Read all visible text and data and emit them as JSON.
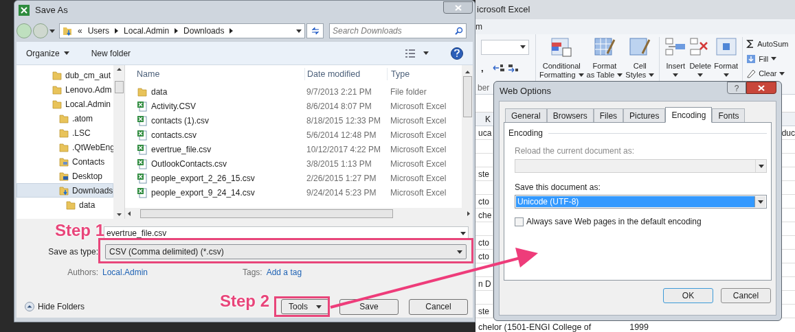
{
  "excel": {
    "title": "icrosoft Excel",
    "tab_fragment": "m",
    "group_fragment": "ber",
    "comma": ",",
    "ribbon": [
      {
        "lines": [
          "Conditional",
          "Formatting"
        ],
        "menu": true,
        "kind": "conditional"
      },
      {
        "lines": [
          "Format",
          "as Table"
        ],
        "menu": true,
        "kind": "table"
      },
      {
        "lines": [
          "Cell",
          "Styles"
        ],
        "menu": true,
        "kind": "styles"
      },
      {
        "lines": [
          "Insert"
        ],
        "menu": true,
        "kind": "insert"
      },
      {
        "lines": [
          "Delete"
        ],
        "menu": true,
        "kind": "delete"
      },
      {
        "lines": [
          "Format"
        ],
        "menu": true,
        "kind": "format"
      }
    ],
    "editing": [
      {
        "label": "AutoSum",
        "menu": false,
        "kind": "sum"
      },
      {
        "label": "Fill",
        "menu": true,
        "kind": "fill"
      },
      {
        "label": "Clear",
        "menu": true,
        "kind": "clear"
      }
    ],
    "header_fragment": "K",
    "rows": [
      {
        "left": "uca",
        "right": "duc"
      },
      {},
      {},
      {
        "left": "ste"
      },
      {},
      {
        "left": "cto"
      },
      {
        "left": "che"
      },
      {},
      {
        "left": "cto"
      },
      {
        "left": "cto"
      },
      {},
      {
        "left": "n D"
      },
      {},
      {
        "left": "ste"
      }
    ],
    "bottom_row": [
      "chelor (",
      "1501-ENGI",
      "College of",
      "1999"
    ]
  },
  "save_as": {
    "title": "Save As",
    "breadcrumb": {
      "prefix": "«",
      "parts": [
        "Users",
        "Local.Admin",
        "Downloads"
      ]
    },
    "search": {
      "placeholder": "Search Downloads"
    },
    "toolbar": {
      "organize": "Organize",
      "new_folder": "New folder"
    },
    "nav": [
      {
        "label": "dub_cm_aut",
        "kind": "folder",
        "selected": false
      },
      {
        "label": "Lenovo.Adm",
        "kind": "folder",
        "selected": false
      },
      {
        "label": "Local.Admin",
        "kind": "folder",
        "selected": false,
        "children": [
          {
            "label": ".atom",
            "kind": "folder",
            "selected": false
          },
          {
            "label": ".LSC",
            "kind": "folder",
            "selected": false
          },
          {
            "label": ".QtWebEng",
            "kind": "folder",
            "selected": false
          },
          {
            "label": "Contacts",
            "kind": "contacts",
            "selected": false
          },
          {
            "label": "Desktop",
            "kind": "desktop",
            "selected": false
          },
          {
            "label": "Downloads",
            "kind": "downloads",
            "selected": true,
            "children": [
              {
                "label": "data",
                "kind": "folder",
                "selected": false
              }
            ]
          }
        ]
      }
    ],
    "columns": [
      "Name",
      "Date modified",
      "Type"
    ],
    "files": [
      {
        "kind": "folder",
        "name": "data",
        "date": "9/7/2013 2:21 PM",
        "type": "File folder"
      },
      {
        "kind": "excel",
        "name": "Activity.CSV",
        "date": "8/6/2014 8:07 PM",
        "type": "Microsoft Excel"
      },
      {
        "kind": "excel",
        "name": "contacts (1).csv",
        "date": "8/18/2015 12:33 PM",
        "type": "Microsoft Excel"
      },
      {
        "kind": "excel",
        "name": "contacts.csv",
        "date": "5/6/2014 12:48 PM",
        "type": "Microsoft Excel"
      },
      {
        "kind": "excel",
        "name": "evertrue_file.csv",
        "date": "10/12/2017 4:22 PM",
        "type": "Microsoft Excel"
      },
      {
        "kind": "excel",
        "name": "OutlookContacts.csv",
        "date": "3/8/2015 1:13 PM",
        "type": "Microsoft Excel"
      },
      {
        "kind": "excel",
        "name": "people_export_2_26_15.csv",
        "date": "2/26/2015 1:27 PM",
        "type": "Microsoft Excel"
      },
      {
        "kind": "excel",
        "name": "people_export_9_24_14.csv",
        "date": "9/24/2014 5:23 PM",
        "type": "Microsoft Excel"
      }
    ],
    "form": {
      "file_name": "evertrue_file.csv",
      "save_type_label": "Save as type:",
      "save_type": "CSV (Comma delimited) (*.csv)",
      "authors_label": "Authors:",
      "authors": "Local.Admin",
      "tags_label": "Tags:",
      "tags": "Add a tag"
    },
    "hide_folders": "Hide Folders",
    "buttons": {
      "tools": "Tools",
      "save": "Save",
      "cancel": "Cancel"
    }
  },
  "web_options": {
    "title": "Web Options",
    "help": "?",
    "tabs": [
      {
        "label": "General",
        "selected": false
      },
      {
        "label": "Browsers",
        "selected": false
      },
      {
        "label": "Files",
        "selected": false
      },
      {
        "label": "Pictures",
        "selected": false
      },
      {
        "label": "Encoding",
        "selected": true
      },
      {
        "label": "Fonts",
        "selected": false
      }
    ],
    "group": "Encoding",
    "reload_label": "Reload the current document as:",
    "reload_disabled": true,
    "save_label": "Save this document as:",
    "save_value": "Unicode (UTF-8)",
    "checkbox": {
      "label": "Always save Web pages in the default encoding",
      "checked": false
    },
    "buttons": [
      "OK",
      "Cancel"
    ]
  },
  "steps": [
    "Step 1",
    "Step 2"
  ]
}
